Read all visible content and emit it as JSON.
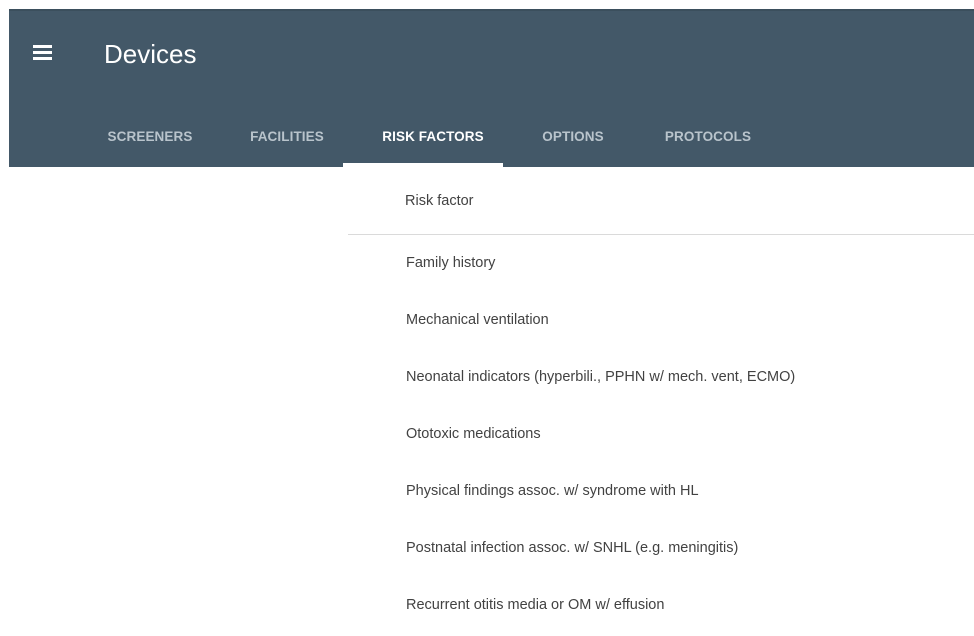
{
  "app": {
    "title": "Devices"
  },
  "tabs": [
    {
      "label": "SCREENERS",
      "active": false
    },
    {
      "label": "FACILITIES",
      "active": false
    },
    {
      "label": "RISK FACTORS",
      "active": true
    },
    {
      "label": "OPTIONS",
      "active": false
    },
    {
      "label": "PROTOCOLS",
      "active": false
    }
  ],
  "list": {
    "header": "Risk factor",
    "items": [
      "Family history",
      "Mechanical ventilation",
      "Neonatal indicators (hyperbili., PPHN w/ mech. vent, ECMO)",
      "Ototoxic medications",
      "Physical findings assoc. w/ syndrome with HL",
      "Postnatal infection assoc. w/ SNHL (e.g. meningitis)",
      "Recurrent otitis media or OM w/ effusion"
    ]
  },
  "colors": {
    "appbar": "#435868",
    "tab_inactive": "#b9c4cc",
    "tab_active": "#ffffff",
    "text": "#424242"
  }
}
